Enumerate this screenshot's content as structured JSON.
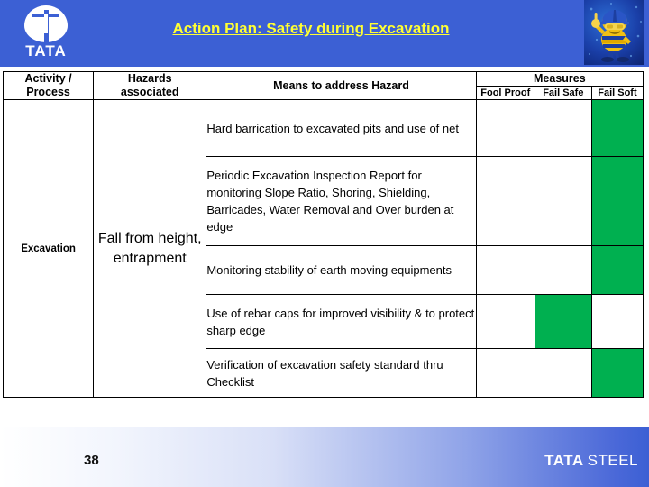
{
  "header": {
    "title": "Action Plan: Safety during Excavation",
    "logo_word": "TATA",
    "logo_icon": "tata-roundel-icon",
    "mascot_icon": "safety-mascot-icon",
    "background_color": "#3C60D4",
    "title_color": "#FFFF33"
  },
  "table": {
    "columns": {
      "activity": "Activity / Process",
      "activity_line1": "Activity /",
      "activity_line2": "Process",
      "hazards": "Hazards associated",
      "hazards_line1": "Hazards",
      "hazards_line2": "associated",
      "means": "Means to address Hazard",
      "measures": "Measures",
      "fool_proof": "Fool Proof",
      "fail_safe": "Fail Safe",
      "fail_soft": "Fail Soft"
    },
    "activity": "Excavation",
    "hazard": "Fall from height, entrapment",
    "mark_color": "#00B050",
    "rows": [
      {
        "means": "Hard barrication to excavated pits and use of net",
        "fool_proof": false,
        "fail_safe": false,
        "fail_soft": true
      },
      {
        "means": "Periodic Excavation Inspection Report for monitoring Slope Ratio, Shoring, Shielding, Barricades, Water Removal and Over burden at edge",
        "fool_proof": false,
        "fail_safe": false,
        "fail_soft": true
      },
      {
        "means": "Monitoring stability of earth moving equipments",
        "fool_proof": false,
        "fail_safe": false,
        "fail_soft": true
      },
      {
        "means": "Use of rebar caps for improved visibility & to protect sharp edge",
        "fool_proof": false,
        "fail_safe": true,
        "fail_soft": false
      },
      {
        "means": "Verification of excavation safety standard thru Checklist",
        "fool_proof": false,
        "fail_safe": false,
        "fail_soft": true
      }
    ]
  },
  "footer": {
    "page_number": "38",
    "brand_bold": "TATA",
    "brand_light": "STEEL"
  }
}
